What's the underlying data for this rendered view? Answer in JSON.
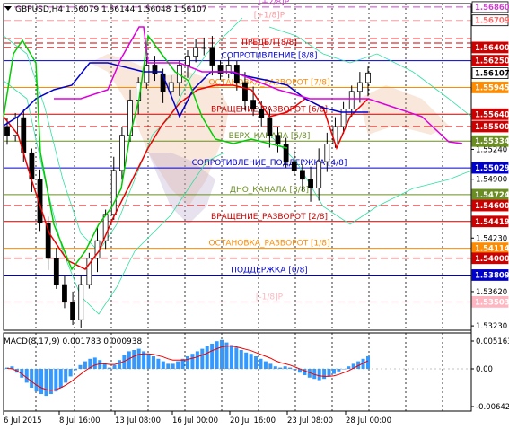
{
  "header": {
    "symbol_line": "GBPUSD,H4  1.56079 1.56144 1.56048 1.56107",
    "triangle_icon": "down-triangle-icon"
  },
  "murrey_levels": [
    {
      "label": "[+2/8]P",
      "price": "1.56860",
      "color": "#d040d0",
      "style": "dash"
    },
    {
      "label": "[+1/8]P",
      "price": "1.56709",
      "color": "#ff9aa0",
      "style": "dash"
    },
    {
      "label": "ПРЕДЕЛ [8/8]",
      "price": "1.56400",
      "color": "#cc0000",
      "style": "dash"
    },
    {
      "label": "СОПРОТИВЛЕНИЕ [8/8]",
      "price": "1.56250",
      "color": "#0000cc",
      "style": "solid"
    },
    {
      "label": "ОСТАНОВКА_РАЗВОРОТ [7/8]",
      "price": "1.55945",
      "color": "#ff8c00",
      "style": "solid"
    },
    {
      "label": "ВРАЩЕНИЕ_РАЗВОРОТ [6/8]",
      "price": "1.55640",
      "color": "#cc0000",
      "style": "solid"
    },
    {
      "label": "ВЕРХ_КАНАЛА [5/8]",
      "price": "1.55334",
      "color": "#6b8e23",
      "style": "solid"
    },
    {
      "label": "СОПРОТИВЛЕНИЕ_ПОДДЕРЖКА [4/8]",
      "price": "1.55029",
      "color": "#0000cc",
      "style": "solid"
    },
    {
      "label": "ДНО_КАНАЛА [3/8]",
      "price": "1.54724",
      "color": "#6b8e23",
      "style": "solid"
    },
    {
      "label": "ВРАЩЕНИЕ_РАЗВОРОТ [2/8]",
      "price": "1.54419",
      "color": "#cc0000",
      "style": "solid"
    },
    {
      "label": "ОСТАНОВКА_РАЗВОРОТ [1/8]",
      "price": "1.54114",
      "color": "#ff8c00",
      "style": "solid"
    },
    {
      "label": "ПОДДЕРЖКА [0/8]",
      "price": "1.53809",
      "color": "#0000cc",
      "style": "solid"
    },
    {
      "label": "[-1/8]P",
      "price": "1.53503",
      "color": "#ffb6c1",
      "style": "dash"
    }
  ],
  "price_axis": {
    "plain_labels": [
      "1.55930",
      "1.55240",
      "1.54900",
      "1.54230",
      "1.53620",
      "1.53230"
    ],
    "badges": [
      {
        "text": "1.56860",
        "bg": "#ffffff",
        "fg": "#d040d0"
      },
      {
        "text": "1.56709",
        "bg": "#ffffff",
        "fg": "#ff6b6b"
      },
      {
        "text": "1.56400",
        "bg": "#cc0000",
        "fg": "#ffffff"
      },
      {
        "text": "1.56250",
        "bg": "#cc0000",
        "fg": "#ffffff"
      },
      {
        "text": "1.56107",
        "bg": "#ffffff",
        "fg": "#000000"
      },
      {
        "text": "1.55945",
        "bg": "#ff8c00",
        "fg": "#ffffff"
      },
      {
        "text": "1.55640",
        "bg": "#cc0000",
        "fg": "#ffffff"
      },
      {
        "text": "1.55500",
        "bg": "#cc0000",
        "fg": "#ffffff"
      },
      {
        "text": "1.55334",
        "bg": "#6b8e23",
        "fg": "#ffffff"
      },
      {
        "text": "1.55029",
        "bg": "#0000cc",
        "fg": "#ffffff"
      },
      {
        "text": "1.54724",
        "bg": "#6b8e23",
        "fg": "#ffffff"
      },
      {
        "text": "1.54600",
        "bg": "#cc0000",
        "fg": "#ffffff"
      },
      {
        "text": "1.54419",
        "bg": "#cc0000",
        "fg": "#ffffff"
      },
      {
        "text": "1.54114",
        "bg": "#ff8c00",
        "fg": "#ffffff"
      },
      {
        "text": "1.54000",
        "bg": "#cc0000",
        "fg": "#ffffff"
      },
      {
        "text": "1.53809",
        "bg": "#0000cc",
        "fg": "#ffffff"
      },
      {
        "text": "1.53503",
        "bg": "#ffb6c1",
        "fg": "#ffffff"
      }
    ]
  },
  "macd": {
    "label": "MACD(8,17,9) 0.001783 0.000938",
    "axis_labels": [
      "0.005163",
      "0.00",
      "-0.006428"
    ],
    "histogram": [
      0.2,
      0.4,
      -0.6,
      -1.4,
      -2.2,
      -3.0,
      -3.6,
      -4.0,
      -4.3,
      -4.0,
      -3.6,
      -3.0,
      -2.2,
      -1.2,
      -0.2,
      0.6,
      1.2,
      1.6,
      1.8,
      1.4,
      0.8,
      0.2,
      0.6,
      1.4,
      2.2,
      2.8,
      3.0,
      3.2,
      2.8,
      2.4,
      2.0,
      1.6,
      1.2,
      0.8,
      0.8,
      1.2,
      1.6,
      2.0,
      2.4,
      2.8,
      3.2,
      3.6,
      4.0,
      4.4,
      4.6,
      4.2,
      3.8,
      3.4,
      3.0,
      2.6,
      2.4,
      2.0,
      1.6,
      1.2,
      0.8,
      0.4,
      0.2,
      0.4,
      0.2,
      -0.2,
      -0.6,
      -1.0,
      -1.4,
      -1.6,
      -1.8,
      -1.6,
      -1.2,
      -0.8,
      -0.4,
      0.0,
      0.4,
      0.8,
      1.2,
      1.6,
      2.0
    ],
    "signal": [
      0.1,
      0.0,
      -0.3,
      -0.8,
      -1.4,
      -2.0,
      -2.6,
      -3.0,
      -3.3,
      -3.4,
      -3.3,
      -3.0,
      -2.6,
      -2.1,
      -1.5,
      -0.9,
      -0.3,
      0.2,
      0.6,
      0.8,
      0.8,
      0.7,
      0.7,
      0.9,
      1.2,
      1.6,
      2.0,
      2.3,
      2.4,
      2.4,
      2.3,
      2.1,
      1.9,
      1.6,
      1.4,
      1.4,
      1.4,
      1.5,
      1.7,
      1.9,
      2.2,
      2.5,
      2.9,
      3.2,
      3.5,
      3.6,
      3.6,
      3.5,
      3.3,
      3.1,
      2.9,
      2.6,
      2.3,
      2.0,
      1.7,
      1.3,
      1.0,
      0.8,
      0.6,
      0.3,
      0.0,
      -0.3,
      -0.6,
      -0.9,
      -1.1,
      -1.2,
      -1.2,
      -1.1,
      -0.9,
      -0.6,
      -0.3,
      0.1,
      0.5,
      0.9,
      1.3
    ]
  },
  "time_axis": [
    "6 Jul 2015",
    "8 Jul 16:00",
    "13 Jul 08:00",
    "16 Jul 00:00",
    "20 Jul 16:00",
    "23 Jul 08:00",
    "28 Jul 00:00"
  ],
  "chart_data": {
    "type": "line",
    "title": "GBPUSD,H4",
    "series": [
      {
        "name": "Price",
        "values": [
          1.554,
          1.556,
          1.552,
          1.549,
          1.544,
          1.54,
          1.537,
          1.535,
          1.533,
          1.537,
          1.54,
          1.542,
          1.545,
          1.55,
          1.554,
          1.558,
          1.56,
          1.562,
          1.561,
          1.559,
          1.56,
          1.562,
          1.563,
          1.564,
          1.564,
          1.562,
          1.561,
          1.562,
          1.56,
          1.558,
          1.557,
          1.556,
          1.554,
          1.553,
          1.551,
          1.55,
          1.549,
          1.548,
          1.551,
          1.553,
          1.555,
          1.557,
          1.559,
          1.56,
          1.5611
        ]
      }
    ],
    "ylim": [
      1.5318,
      1.569
    ]
  },
  "colors": {
    "candle": "#000000",
    "ma_red": "#ee0000",
    "ma_blue": "#0000cc",
    "ma_green": "#00cc00",
    "ma_magenta": "#dd00dd",
    "envelope": "#30e0a0",
    "cloud": "#e8a070",
    "cloud2": "#b0a0c8",
    "macd_hist": "#3399ff",
    "macd_signal": "#ee0000",
    "separator": "#000000"
  }
}
